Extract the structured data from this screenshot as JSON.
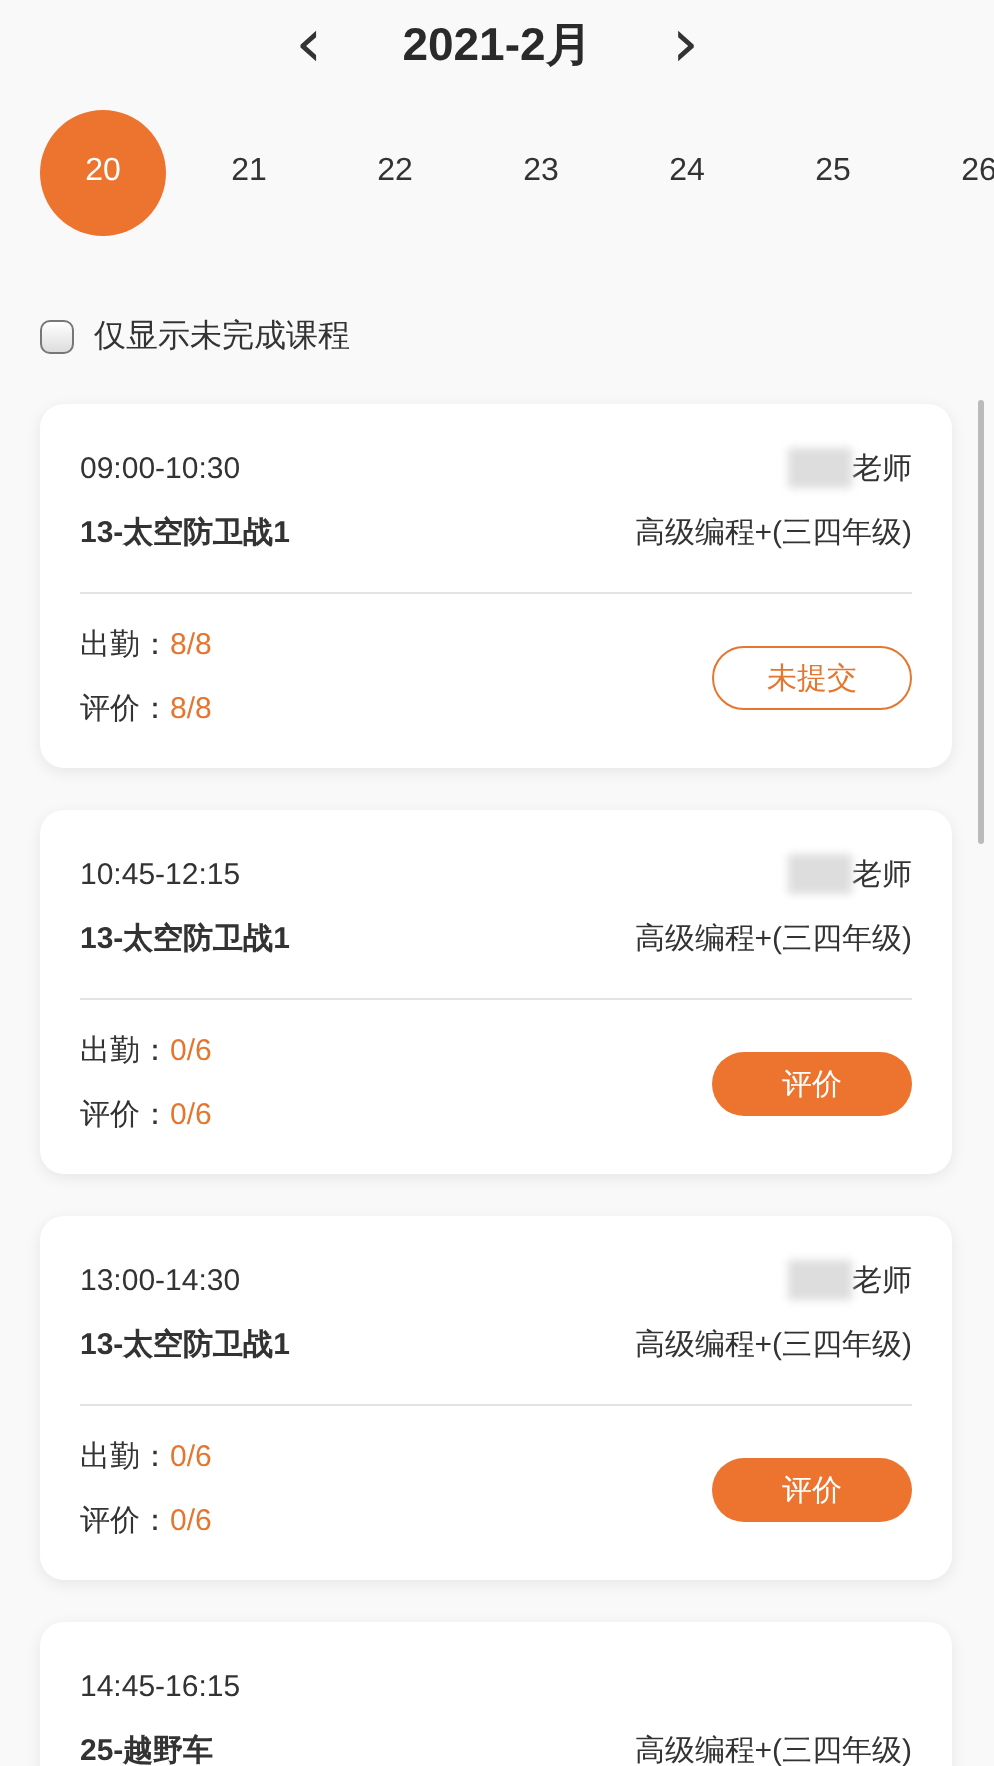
{
  "header": {
    "title": "2021-2月",
    "prev": "‹",
    "next": "›"
  },
  "dates": [
    {
      "label": "20",
      "selected": true
    },
    {
      "label": "21",
      "selected": false
    },
    {
      "label": "22",
      "selected": false
    },
    {
      "label": "23",
      "selected": false
    },
    {
      "label": "24",
      "selected": false
    },
    {
      "label": "25",
      "selected": false
    },
    {
      "label": "26",
      "selected": false
    }
  ],
  "filter": {
    "label": "仅显示未完成课程",
    "checked": false
  },
  "lessons": [
    {
      "time": "09:00-10:30",
      "teacher": "老师",
      "title": "13-太空防卫战1",
      "course": "高级编程+(三四年级)",
      "attendance_label": "出勤：",
      "attendance": "8/8",
      "evaluation_label": "评价：",
      "evaluation": "8/8",
      "button": {
        "label": "未提交",
        "kind": "outline"
      }
    },
    {
      "time": "10:45-12:15",
      "teacher": "老师",
      "title": "13-太空防卫战1",
      "course": "高级编程+(三四年级)",
      "attendance_label": "出勤：",
      "attendance": "0/6",
      "evaluation_label": "评价：",
      "evaluation": "0/6",
      "button": {
        "label": "评价",
        "kind": "filled"
      }
    },
    {
      "time": "13:00-14:30",
      "teacher": "老师",
      "title": "13-太空防卫战1",
      "course": "高级编程+(三四年级)",
      "attendance_label": "出勤：",
      "attendance": "0/6",
      "evaluation_label": "评价：",
      "evaluation": "0/6",
      "button": {
        "label": "评价",
        "kind": "filled"
      }
    },
    {
      "time": "14:45-16:15",
      "title": "25-越野车",
      "course": "高级编程+(三四年级)"
    }
  ]
}
